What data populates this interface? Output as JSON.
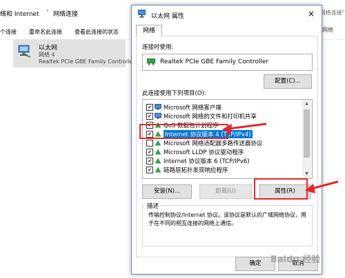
{
  "explorer": {
    "breadcrumb": [
      "络和 Internet",
      "网络连接"
    ],
    "right_fragment": "\"网络连接\"",
    "commands": [
      "个连接",
      "重命名此连接",
      "查看此连接的状态"
    ],
    "adapter": {
      "name": "以太网",
      "network": "网络  4",
      "device": "Realtek PCIe GBE Family Controller"
    },
    "side_fragment": "网络"
  },
  "dialog": {
    "title": "以太网 属性",
    "close": "×",
    "tab": "网络",
    "connect_using_label": "连接时使用:",
    "adapter_name": "Realtek PCIe GBE Family Controller",
    "configure_button": "配置(C)...",
    "items_label": "此连接使用下列项目(O):",
    "items": [
      {
        "label": "Microsoft 网络客户端",
        "checked": true
      },
      {
        "label": "Microsoft 网络的文件和打印机共享",
        "checked": true
      },
      {
        "label": "QoS 数据包计划程序",
        "checked": true
      },
      {
        "label": "Internet 协议版本 4 (TCP/IPv4)",
        "checked": true,
        "selected": true
      },
      {
        "label": "Microsoft 网络适配器多路传送器协议",
        "checked": false
      },
      {
        "label": "Microsoft LLDP 协议驱动程序",
        "checked": true
      },
      {
        "label": "Internet 协议版本 6 (TCP/IPv6)",
        "checked": true
      },
      {
        "label": "链路层拓扑发现响应程序",
        "checked": true
      }
    ],
    "install_button": "安装(N)...",
    "uninstall_button": "卸载(U)",
    "properties_button": "属性(R)",
    "description_title": "描述",
    "description_text": "传输控制协议/Internet 协议。该协议是默认的广域网络协议，用于在不同的相互连接的网络上通信。",
    "ok_button": "确定",
    "cancel_button": "取消"
  },
  "watermark": "Baidu 经验",
  "colors": {
    "annotation": "#e8232a",
    "selection": "#0078d7",
    "adapter_bg": "#e2e2e2"
  }
}
